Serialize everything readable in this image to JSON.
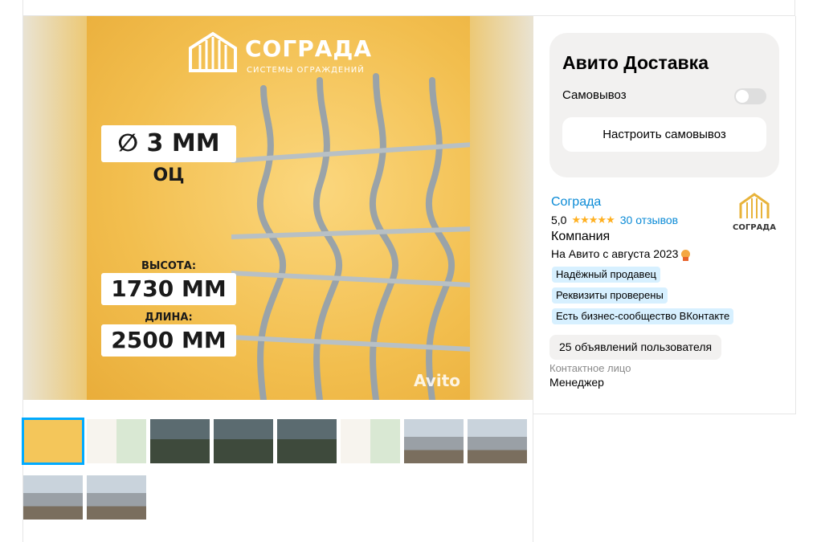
{
  "listing_photo": {
    "brand_name": "СОГРАДА",
    "brand_subtitle": "СИСТЕМЫ ОГРАЖДЕНИЙ",
    "diameter": "∅ 3 ММ",
    "coating": "ОЦ",
    "height_label": "ВЫСОТА:",
    "height_value": "1730 ММ",
    "length_label": "ДЛИНА:",
    "length_value": "2500 ММ",
    "watermark": "Avito"
  },
  "thumbnails": [
    {
      "kind": "poster",
      "active": true
    },
    {
      "kind": "map"
    },
    {
      "kind": "dark"
    },
    {
      "kind": "dark"
    },
    {
      "kind": "dark"
    },
    {
      "kind": "map"
    },
    {
      "kind": "building"
    },
    {
      "kind": "building"
    },
    {
      "kind": "building"
    },
    {
      "kind": "building"
    }
  ],
  "delivery": {
    "title": "Авито Доставка",
    "pickup_label": "Самовывоз",
    "pickup_enabled": false,
    "setup_button": "Настроить самовывоз"
  },
  "seller": {
    "name": "Сограда",
    "rating": "5,0",
    "stars": "★★★★★",
    "reviews": "30 отзывов",
    "type": "Компания",
    "since": "На Авито с августа 2023",
    "logo_text": "СОГРАДА",
    "badges": [
      "Надёжный продавец",
      "Реквизиты проверены",
      "Есть бизнес-сообщество ВКонтакте"
    ],
    "ads_button": "25 объявлений пользователя",
    "contact_label": "Контактное лицо",
    "contact_value": "Менеджер"
  },
  "colors": {
    "accent_link": "#0a8ad6",
    "badge_bg": "#d7f0ff",
    "star": "#ffb021",
    "thumb_active": "#00aaff"
  }
}
